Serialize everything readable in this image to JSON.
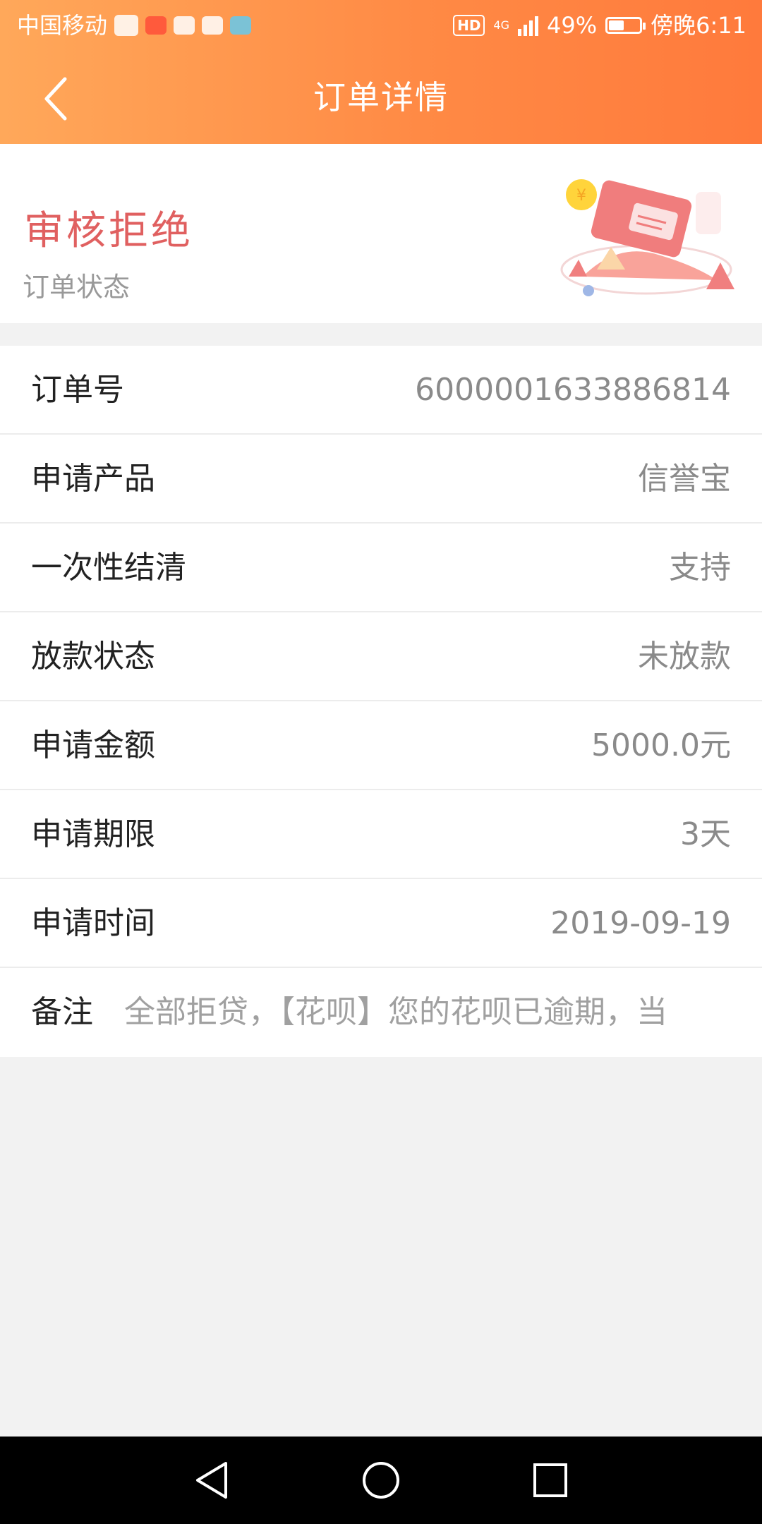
{
  "status_bar": {
    "carrier": "中国移动",
    "hd": "HD",
    "network": "4G",
    "battery": "49%",
    "time": "傍晚6:11"
  },
  "header": {
    "title": "订单详情"
  },
  "status_card": {
    "status": "审核拒绝",
    "label": "订单状态"
  },
  "details": [
    {
      "label": "订单号",
      "value": "6000001633886814"
    },
    {
      "label": "申请产品",
      "value": "信誉宝"
    },
    {
      "label": "一次性结清",
      "value": "支持"
    },
    {
      "label": "放款状态",
      "value": "未放款"
    },
    {
      "label": "申请金额",
      "value": "5000.0元"
    },
    {
      "label": "申请期限",
      "value": "3天"
    },
    {
      "label": "申请时间",
      "value": "2019-09-19"
    },
    {
      "label": "备注",
      "value": "全部拒贷，【花呗】您的花呗已逾期，当"
    }
  ],
  "colors": {
    "accent_start": "#ffa85a",
    "accent_end": "#ff7a3c",
    "status_red": "#e06060"
  }
}
